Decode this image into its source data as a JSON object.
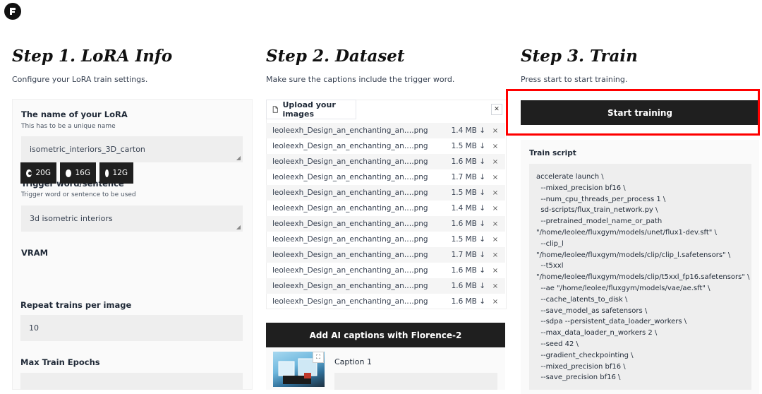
{
  "step1": {
    "title": "Step 1. LoRA Info",
    "subtitle": "Configure your LoRA train settings.",
    "lora_name_label": "The name of your LoRA",
    "lora_name_hint": "This has to be a unique name",
    "lora_name_value": "isometric_interiors_3D_carton",
    "trigger_label": "Trigger word/sentence",
    "trigger_hint": "Trigger word or sentence to be used",
    "trigger_value": "3d isometric interiors",
    "vram_label": "VRAM",
    "vram_options": [
      "20G",
      "16G",
      "12G"
    ],
    "vram_selected": "20G",
    "repeat_label": "Repeat trains per image",
    "repeat_value": "10",
    "epochs_label": "Max Train Epochs"
  },
  "step2": {
    "title": "Step 2. Dataset",
    "subtitle": "Make sure the captions include the trigger word.",
    "upload_label": "Upload your images",
    "files": [
      {
        "name": "leoleexh_Design_an_enchanting_an….png",
        "size": "1.4 MB ↓"
      },
      {
        "name": "leoleexh_Design_an_enchanting_an….png",
        "size": "1.5 MB ↓"
      },
      {
        "name": "leoleexh_Design_an_enchanting_an….png",
        "size": "1.6 MB ↓"
      },
      {
        "name": "leoleexh_Design_an_enchanting_an….png",
        "size": "1.7 MB ↓"
      },
      {
        "name": "leoleexh_Design_an_enchanting_an….png",
        "size": "1.5 MB ↓"
      },
      {
        "name": "leoleexh_Design_an_enchanting_an….png",
        "size": "1.4 MB ↓"
      },
      {
        "name": "leoleexh_Design_an_enchanting_an….png",
        "size": "1.6 MB ↓"
      },
      {
        "name": "leoleexh_Design_an_enchanting_an….png",
        "size": "1.5 MB ↓"
      },
      {
        "name": "leoleexh_Design_an_enchanting_an….png",
        "size": "1.7 MB ↓"
      },
      {
        "name": "leoleexh_Design_an_enchanting_an….png",
        "size": "1.6 MB ↓"
      },
      {
        "name": "leoleexh_Design_an_enchanting_an….png",
        "size": "1.6 MB ↓"
      },
      {
        "name": "leoleexh_Design_an_enchanting_an….png",
        "size": "1.6 MB ↓"
      }
    ],
    "caption_button": "Add AI captions with Florence-2",
    "caption_label": "Caption 1"
  },
  "step3": {
    "title": "Step 3. Train",
    "subtitle": "Press start to start training.",
    "start_button": "Start training",
    "script_label": "Train script",
    "script_text": "accelerate launch \\\n  --mixed_precision bf16 \\\n  --num_cpu_threads_per_process 1 \\\n  sd-scripts/flux_train_network.py \\\n  --pretrained_model_name_or_path\n\"/home/leolee/fluxgym/models/unet/flux1-dev.sft\" \\\n  --clip_l\n\"/home/leolee/fluxgym/models/clip/clip_l.safetensors\" \\\n  --t5xxl\n\"/home/leolee/fluxgym/models/clip/t5xxl_fp16.safetensors\" \\\n  --ae \"/home/leolee/fluxgym/models/vae/ae.sft\" \\\n  --cache_latents_to_disk \\\n  --save_model_as safetensors \\\n  --sdpa --persistent_data_loader_workers \\\n  --max_data_loader_n_workers 2 \\\n  --seed 42 \\\n  --gradient_checkpointing \\\n  --mixed_precision bf16 \\\n  --save_precision bf16 \\"
  },
  "icons": {
    "logo": "fluxgym-logo",
    "upload": "file-icon",
    "close": "close-icon",
    "download": "download-arrow",
    "remove": "remove-icon"
  },
  "colors": {
    "dark_button": "#1f1f1f",
    "highlight": "#ff0000"
  }
}
